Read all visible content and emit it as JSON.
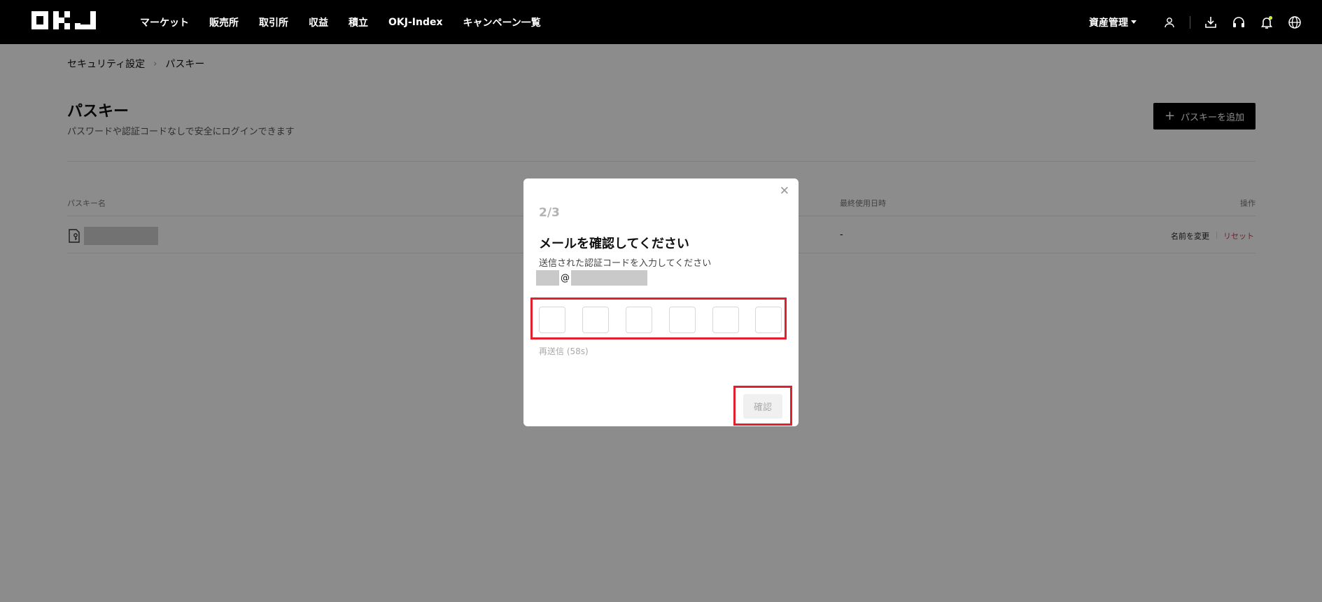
{
  "nav": {
    "logo": "OKJ",
    "links": [
      "マーケット",
      "販売所",
      "取引所",
      "収益",
      "積立",
      "OKJ-Index",
      "キャンペーン一覧"
    ],
    "asset_menu": "資産管理",
    "icons": [
      "user-icon",
      "download-icon",
      "headset-icon",
      "bell-icon",
      "globe-icon"
    ]
  },
  "breadcrumb": {
    "parent": "セキュリティ設定",
    "current": "パスキー"
  },
  "page": {
    "title": "パスキー",
    "subtitle": "パスワードや認証コードなしで安全にログインできます",
    "add_button": "パスキーを追加"
  },
  "table": {
    "headers": {
      "name": "パスキー名",
      "last_used": "最終使用日時",
      "actions": "操作"
    },
    "rows": [
      {
        "last_used": "-",
        "rename": "名前を変更",
        "reset": "リセット"
      }
    ]
  },
  "modal": {
    "step": "2/3",
    "title": "メールを確認してください",
    "subtitle": "送信された認証コードを入力してください",
    "email_at": "@",
    "code_length": 6,
    "resend": "再送信 (58s)",
    "confirm": "確認"
  },
  "colors": {
    "accent_red": "#e0202c",
    "reset_link": "#d23c58",
    "nav_bg": "#000000"
  }
}
